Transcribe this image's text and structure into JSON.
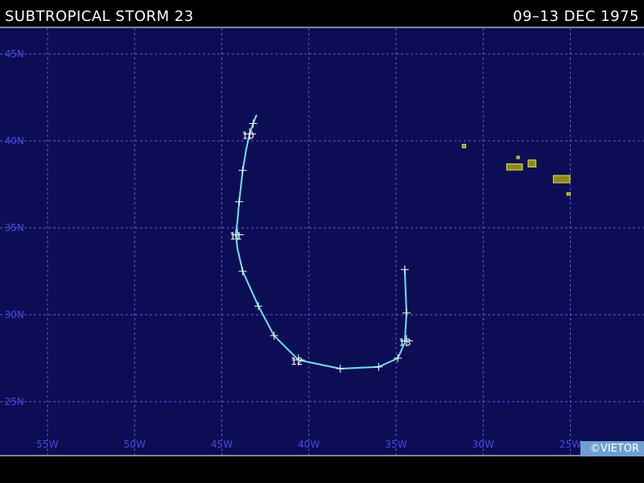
{
  "header": {
    "storm_name": "SUBTROPICAL STORM 23",
    "dates": "09–13 DEC 1975"
  },
  "copyright": "©VIETOR",
  "colors": {
    "map_background": "#0d0d55",
    "grid": "#5a5ae6",
    "axis_labels": "#4848e0",
    "track": "#66e6ea",
    "land_fill": "#8a8a1e",
    "land_outline": "#e6e64a"
  },
  "chart_data": {
    "type": "map-track",
    "lon_ticks": [
      {
        "value": -55,
        "label": "55W"
      },
      {
        "value": -50,
        "label": "50W"
      },
      {
        "value": -45,
        "label": "45W"
      },
      {
        "value": -40,
        "label": "40W"
      },
      {
        "value": -35,
        "label": "35W"
      },
      {
        "value": -30,
        "label": "30W"
      },
      {
        "value": -25,
        "label": "25W"
      }
    ],
    "lat_ticks": [
      {
        "value": 45,
        "label": "45N"
      },
      {
        "value": 40,
        "label": "40N"
      },
      {
        "value": 35,
        "label": "35N"
      },
      {
        "value": 30,
        "label": "30N"
      },
      {
        "value": 25,
        "label": "25N"
      }
    ],
    "track": [
      {
        "lon": -43.0,
        "lat": 41.5
      },
      {
        "lon": -43.2,
        "lat": 41.0
      },
      {
        "lon": -43.4,
        "lat": 40.4
      },
      {
        "lon": -43.6,
        "lat": 39.5
      },
      {
        "lon": -43.8,
        "lat": 38.3
      },
      {
        "lon": -44.0,
        "lat": 36.5
      },
      {
        "lon": -44.1,
        "lat": 35.4
      },
      {
        "lon": -44.2,
        "lat": 34.6
      },
      {
        "lon": -44.1,
        "lat": 33.8
      },
      {
        "lon": -43.8,
        "lat": 32.5
      },
      {
        "lon": -42.9,
        "lat": 30.5
      },
      {
        "lon": -42.0,
        "lat": 28.8
      },
      {
        "lon": -40.6,
        "lat": 27.4
      },
      {
        "lon": -38.2,
        "lat": 26.9
      },
      {
        "lon": -36.0,
        "lat": 27.0
      },
      {
        "lon": -34.9,
        "lat": 27.5
      },
      {
        "lon": -34.5,
        "lat": 28.4
      },
      {
        "lon": -34.4,
        "lat": 30.1
      },
      {
        "lon": -34.5,
        "lat": 32.6
      }
    ],
    "tick_marks": [
      {
        "lon": -43.2,
        "lat": 41.0
      },
      {
        "lon": -43.8,
        "lat": 38.3
      },
      {
        "lon": -44.0,
        "lat": 36.5
      },
      {
        "lon": -43.8,
        "lat": 32.5
      },
      {
        "lon": -42.9,
        "lat": 30.5
      },
      {
        "lon": -42.0,
        "lat": 28.8
      },
      {
        "lon": -38.2,
        "lat": 26.9
      },
      {
        "lon": -36.0,
        "lat": 27.0
      },
      {
        "lon": -34.9,
        "lat": 27.5
      },
      {
        "lon": -34.4,
        "lat": 30.1
      },
      {
        "lon": -34.5,
        "lat": 32.6
      }
    ],
    "day_marks": [
      {
        "lon": -43.4,
        "lat": 40.4,
        "label": "10"
      },
      {
        "lon": -44.1,
        "lat": 34.6,
        "label": "11"
      },
      {
        "lon": -40.6,
        "lat": 27.4,
        "label": "12"
      },
      {
        "lon": -34.4,
        "lat": 28.5,
        "label": "13"
      }
    ],
    "islands": [
      {
        "name": "azores-corvo",
        "lon": -31.1,
        "lat": 39.7,
        "w": 0.2,
        "h": 0.2
      },
      {
        "name": "azores-graciosa",
        "lon": -28.0,
        "lat": 39.05,
        "w": 0.15,
        "h": 0.12
      },
      {
        "name": "azores-faial-pico",
        "lon": -28.2,
        "lat": 38.5,
        "w": 0.9,
        "h": 0.35
      },
      {
        "name": "azores-terceira",
        "lon": -27.2,
        "lat": 38.7,
        "w": 0.45,
        "h": 0.4
      },
      {
        "name": "azores-sao-miguel",
        "lon": -25.5,
        "lat": 37.8,
        "w": 0.95,
        "h": 0.42
      },
      {
        "name": "azores-santa-maria",
        "lon": -25.1,
        "lat": 36.95,
        "w": 0.2,
        "h": 0.15
      }
    ]
  }
}
